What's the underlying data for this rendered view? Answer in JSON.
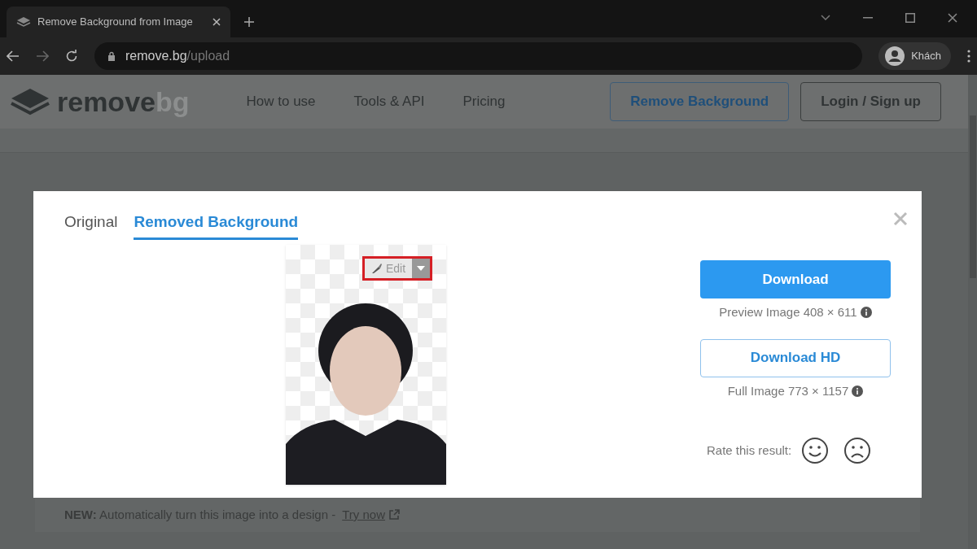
{
  "browser": {
    "tab_title": "Remove Background from Image",
    "url_host": "remove.bg",
    "url_path": "/upload",
    "profile": "Khách"
  },
  "site_header": {
    "logo_word": "remove",
    "logo_word_faded": "bg",
    "nav": [
      "How to use",
      "Tools & API",
      "Pricing"
    ],
    "buttons": [
      {
        "label": "Remove Background",
        "kind": "primary"
      },
      {
        "label": "Login / Sign up",
        "kind": "secondary"
      }
    ]
  },
  "modal": {
    "tabs": [
      {
        "label": "Original",
        "selected": false
      },
      {
        "label": "Removed Background",
        "selected": true
      }
    ],
    "edit_button": {
      "label": "Edit",
      "highlighted": true
    },
    "downloads": [
      {
        "label": "Download",
        "kind": "filled",
        "caption": "Preview Image 408 × 611"
      },
      {
        "label": "Download HD",
        "kind": "outline",
        "caption": "Full Image 773 × 1157"
      }
    ],
    "rate_label": "Rate this result:"
  },
  "banner": {
    "lead": "NEW:",
    "text": "Automatically turn this image into a design -",
    "link": "Try now"
  }
}
